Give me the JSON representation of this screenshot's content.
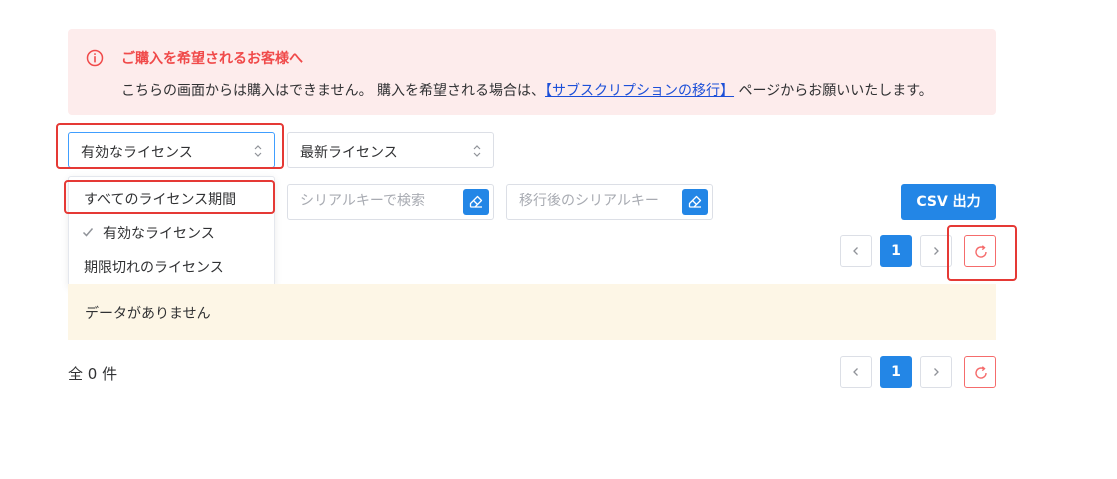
{
  "alert": {
    "title": "ご購入を希望されるお客様へ",
    "body_prefix": "こちらの画面からは購入はできません。 購入を希望される場合は、",
    "link_text": "【サブスクリプションの移行】",
    "body_suffix": " ページからお願いいたします。",
    "icon": "info-circle-icon",
    "color": "#f04a4a"
  },
  "filters": {
    "status_select": {
      "value": "有効なライセンス"
    },
    "sort_select": {
      "value": "最新ライセンス"
    },
    "serial_search": {
      "placeholder": "シリアルキーで検索"
    },
    "migrated_search": {
      "placeholder": "移行後のシリアルキー"
    },
    "csv_button": "CSV 出力"
  },
  "dropdown": {
    "options": [
      {
        "label": "すべてのライセンス期間",
        "checked": false
      },
      {
        "label": "有効なライセンス",
        "checked": true
      },
      {
        "label": "期限切れのライセンス",
        "checked": false
      }
    ]
  },
  "pagination": {
    "current_page": "1"
  },
  "table": {
    "empty_text": "データがありません"
  },
  "footer": {
    "total": "全 0 件"
  },
  "colors": {
    "primary": "#2386e6",
    "alert_bg": "#fdecec",
    "empty_bg": "#fdf6e6",
    "highlight": "#e53935"
  }
}
